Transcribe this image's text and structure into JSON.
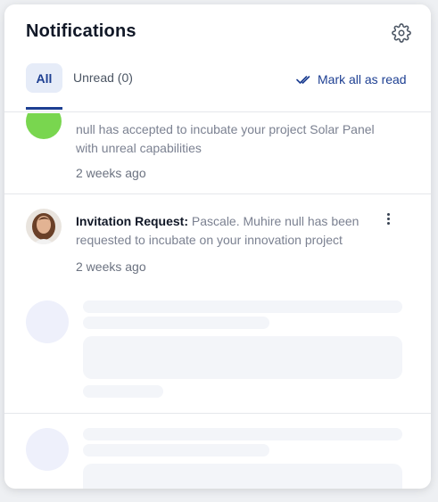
{
  "header": {
    "title": "Notifications",
    "settings_icon": "gear-icon"
  },
  "tabs": {
    "all_label": "All",
    "unread_label": "Unread (0)",
    "mark_all_label": "Mark all as read",
    "mark_all_icon": "double-check-icon"
  },
  "notifications": [
    {
      "text": "null has accepted to incubate your project Solar Panel with unreal capabilities",
      "time": "2 weeks ago"
    },
    {
      "title": "Invitation Request:",
      "text": "Pascale. Muhire null has been requested to incubate on your innovation project",
      "time": "2 weeks ago"
    }
  ],
  "colors": {
    "accent": "#1d3f92",
    "tab_bg": "#e6ecf8",
    "skeleton": "#f3f5f9"
  }
}
